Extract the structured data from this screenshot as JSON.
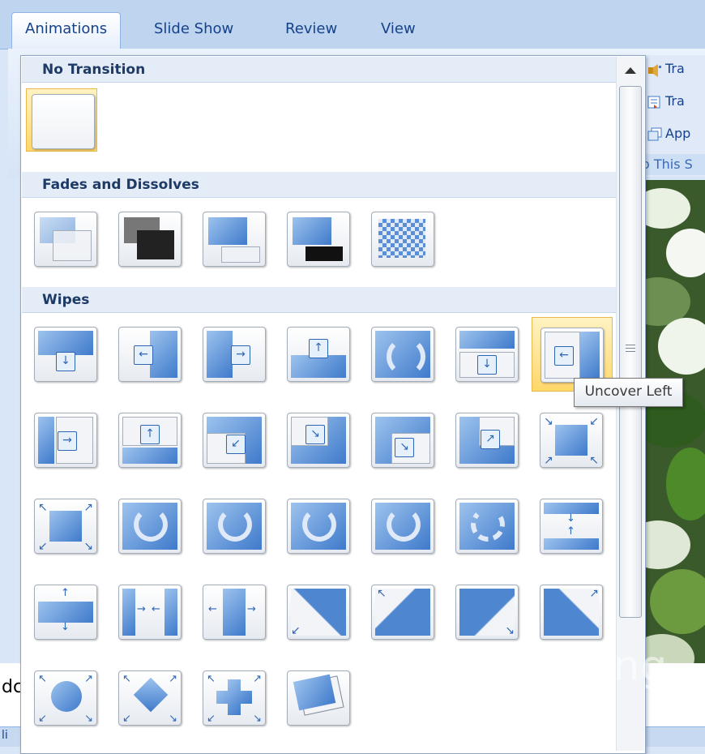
{
  "tabs": [
    {
      "label": "Animations",
      "active": true
    },
    {
      "label": "Slide Show",
      "active": false
    },
    {
      "label": "Review",
      "active": false
    },
    {
      "label": "View",
      "active": false
    }
  ],
  "right_group": {
    "items": [
      {
        "label": "Tra",
        "icon": "transition-sound-icon"
      },
      {
        "label": "Tra",
        "icon": "transition-speed-icon"
      },
      {
        "label": "App",
        "icon": "apply-to-all-icon"
      }
    ],
    "group_label": "o This S"
  },
  "gallery": {
    "sections": [
      {
        "title": "No Transition"
      },
      {
        "title": "Fades and Dissolves"
      },
      {
        "title": "Wipes"
      }
    ],
    "tooltip": "Uncover Left"
  },
  "bottom": {
    "partial_text": "dc",
    "strip_text": "li"
  },
  "watermark": {
    "text": "uantrimang"
  },
  "colors": {
    "tab_bar": "#bfd4ee",
    "highlight": "#ffd76a",
    "accent_blue": "#3f7acb"
  }
}
